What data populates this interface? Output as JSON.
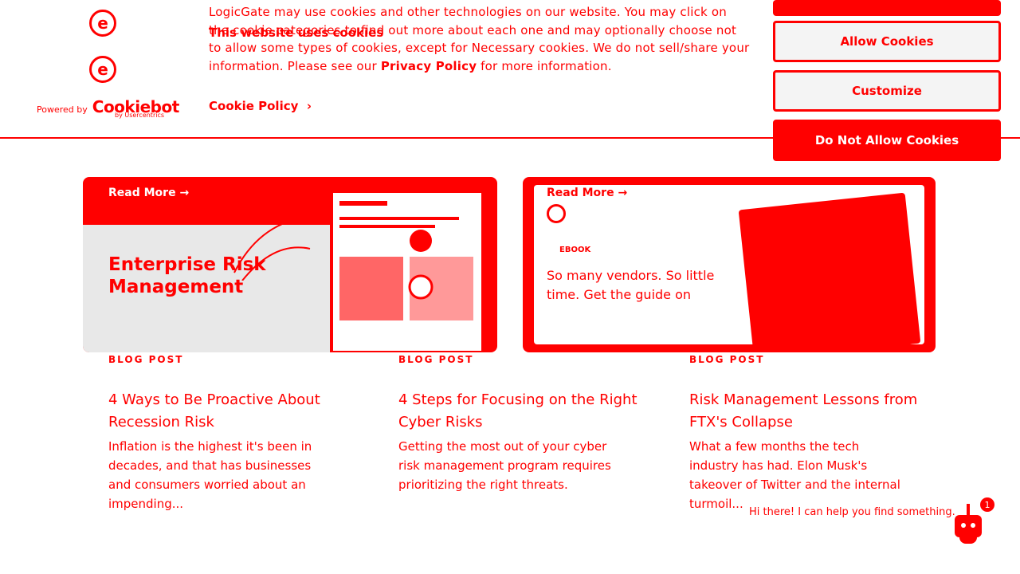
{
  "banner": {
    "title": "This website uses cookies",
    "text_start": "LogicGate may use cookies and other technologies on our website. You may click on the cookie categories to find out more about each one and may optionally choose not to allow some types of cookies, except for Necessary cookies.  We do not sell/share your information. Please see our ",
    "privacy_link": "Privacy Policy",
    "text_end": " for more information.",
    "cookie_policy_link": "Cookie Policy",
    "powered_by": "Powered by",
    "cookiebot": "Cookiebot",
    "by_usercentrics": "by Usercentrics"
  },
  "buttons": {
    "allow": "Allow Cookies",
    "customize": "Customize",
    "do_not_allow": "Do Not Allow Cookies"
  },
  "cards": {
    "card1": {
      "read_more": "Read More",
      "title": "Enterprise Risk Management"
    },
    "card2": {
      "read_more": "Read More",
      "eyebrow": "EBOOK",
      "text": "So many vendors. So little time. Get the guide on"
    }
  },
  "posts": [
    {
      "category": "BLOG POST",
      "title": "4 Ways to Be Proactive About Recession Risk",
      "excerpt": "Inflation is the highest it's been in decades, and that has businesses and consumers worried about an impending..."
    },
    {
      "category": "BLOG POST",
      "title": "4 Steps for Focusing on the Right Cyber Risks",
      "excerpt": "Getting the most out of your cyber risk management program requires prioritizing the right threats."
    },
    {
      "category": "BLOG POST",
      "title": "Risk Management Lessons from FTX's Collapse",
      "excerpt": "What a few months the tech industry has had.  Elon Musk's takeover of Twitter and the internal turmoil..."
    }
  ],
  "chat": {
    "greeting": "Hi there! I can help you find something.",
    "badge_count": "1"
  },
  "colors": {
    "accent": "#ff0000",
    "background": "#ffffff"
  }
}
